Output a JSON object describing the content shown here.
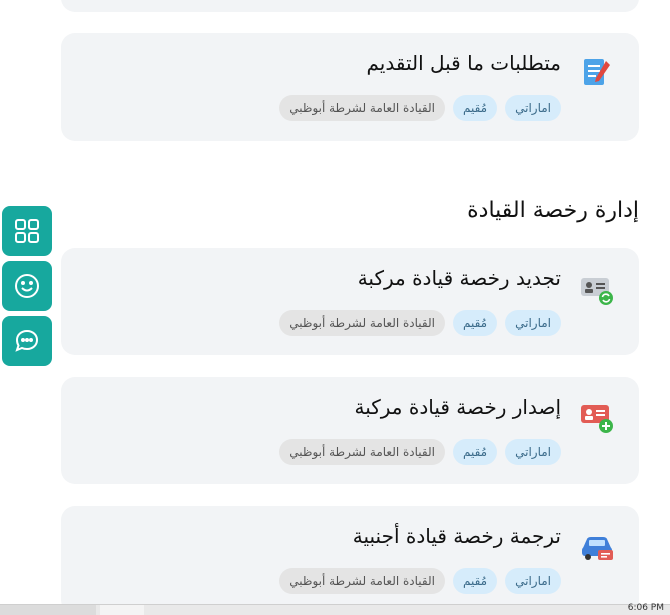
{
  "cards_top": [
    {
      "title": "متطلبات ما قبل التقديم",
      "icon": "document-pen-icon",
      "tags": [
        "اماراتي",
        "مُقيم",
        "القيادة العامة لشرطة أبوظبي"
      ]
    }
  ],
  "section": {
    "title": "إدارة رخصة القيادة"
  },
  "cards": [
    {
      "title": "تجديد رخصة قيادة مركبة",
      "icon": "license-renew-icon",
      "tags": [
        "اماراتي",
        "مُقيم",
        "القيادة العامة لشرطة أبوظبي"
      ]
    },
    {
      "title": "إصدار رخصة قيادة مركبة",
      "icon": "license-add-icon",
      "tags": [
        "اماراتي",
        "مُقيم",
        "القيادة العامة لشرطة أبوظبي"
      ]
    },
    {
      "title": "ترجمة رخصة قيادة أجنبية",
      "icon": "car-license-icon",
      "tags": [
        "اماراتي",
        "مُقيم",
        "القيادة العامة لشرطة أبوظبي"
      ]
    }
  ],
  "side_actions": [
    "grid-icon",
    "smiley-icon",
    "chat-icon"
  ],
  "taskbar": {
    "clock": "6:06 PM"
  },
  "colors": {
    "accent": "#17a89e",
    "card_bg": "#f2f4f6",
    "tag_blue": "#d6ecfb",
    "tag_gray": "#e4e4e4"
  }
}
